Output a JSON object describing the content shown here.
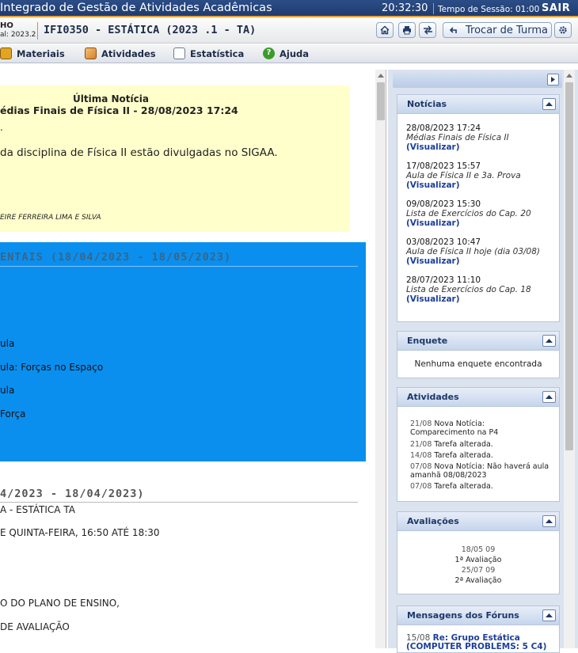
{
  "topbar": {
    "system_title": "Integrado de Gestão de Atividades Acadêmicas",
    "clock": "20:32:30",
    "session_label": "Tempo de Sessão: 01:00",
    "logout": "SAIR"
  },
  "header": {
    "user_name": "HO",
    "semester": "al: 2023.2",
    "course_title": "IFI0350 - ESTÁTICA (2023 .1 - TA)",
    "change_class_label": "Trocar de Turma"
  },
  "menu": {
    "items": [
      {
        "label": "Materiais",
        "icon": "books-icon",
        "color": "#e1a520"
      },
      {
        "label": "Atividades",
        "icon": "pencil-icon",
        "color": "#e49a3a"
      },
      {
        "label": "Estatística",
        "icon": "document-icon",
        "color": "#ffffff"
      },
      {
        "label": "Ajuda",
        "icon": "help-icon",
        "color": "#3c9c2a"
      }
    ]
  },
  "main": {
    "news": {
      "header": "Última Notícia",
      "title": "édias Finais de Física II - 28/08/2023 17:24",
      "dot": ".",
      "text": "da disciplina de Física II estão divulgadas no SIGAA.",
      "author": "EIRE FERREIRA LIMA E SILVA"
    },
    "topic1": {
      "heading": "ENTAIS (18/04/2023 - 18/05/2023)",
      "lines": [
        "ula",
        "ula: Forças no Espaço",
        "ula",
        "Força"
      ]
    },
    "topic2": {
      "heading": "4/2023 - 18/04/2023)",
      "lines": [
        "A - ESTÁTICA TA",
        "E QUINTA-FEIRA, 16:50 ATÉ 18:30",
        "O DO PLANO DE ENSINO,",
        "DE AVALIAÇÃO"
      ]
    }
  },
  "sidebar": {
    "news_panel": {
      "title": "Notícias",
      "items": [
        {
          "date": "28/08/2023 17:24",
          "title": "Médias Finais de Física II",
          "link": "(Visualizar)"
        },
        {
          "date": "17/08/2023 15:57",
          "title": "Aula de Física II e 3a. Prova",
          "link": "(Visualizar)"
        },
        {
          "date": "09/08/2023 15:30",
          "title": "Lista de Exercícios do Cap. 20",
          "link": "(Visualizar)"
        },
        {
          "date": "03/08/2023 10:47",
          "title": "Aula de Física II hoje (dia 03/08)",
          "link": "(Visualizar)"
        },
        {
          "date": "28/07/2023 11:10",
          "title": "Lista de Exercícios do Cap. 18",
          "link": "(Visualizar)"
        }
      ]
    },
    "poll_panel": {
      "title": "Enquete",
      "empty": "Nenhuma enquete encontrada"
    },
    "activities_panel": {
      "title": "Atividades",
      "items": [
        {
          "date": "21/08",
          "text": "Nova Notícia:",
          "text2": "Comparecimento na P4"
        },
        {
          "date": "21/08",
          "text": "Tarefa alterada.",
          "text2": ""
        },
        {
          "date": "14/08",
          "text": "Tarefa alterada.",
          "text2": ""
        },
        {
          "date": "07/08",
          "text": "Nova Notícia: Não haverá aula",
          "text2": "amanhã 08/08/2023"
        },
        {
          "date": "07/08",
          "text": "Tarefa alterada.",
          "text2": ""
        }
      ]
    },
    "evaluations_panel": {
      "title": "Avaliações",
      "items": [
        {
          "date": "18/05 09",
          "name": "1ª Avaliação"
        },
        {
          "date": "25/07 09",
          "name": "2ª Avaliação"
        }
      ]
    },
    "forums_panel": {
      "title": "Mensagens dos Fóruns",
      "items": [
        {
          "date": "15/08",
          "title": "Re: Grupo Estática",
          "title2": "(COMPUTER PROBLEMS: 5 C4)"
        }
      ]
    }
  }
}
